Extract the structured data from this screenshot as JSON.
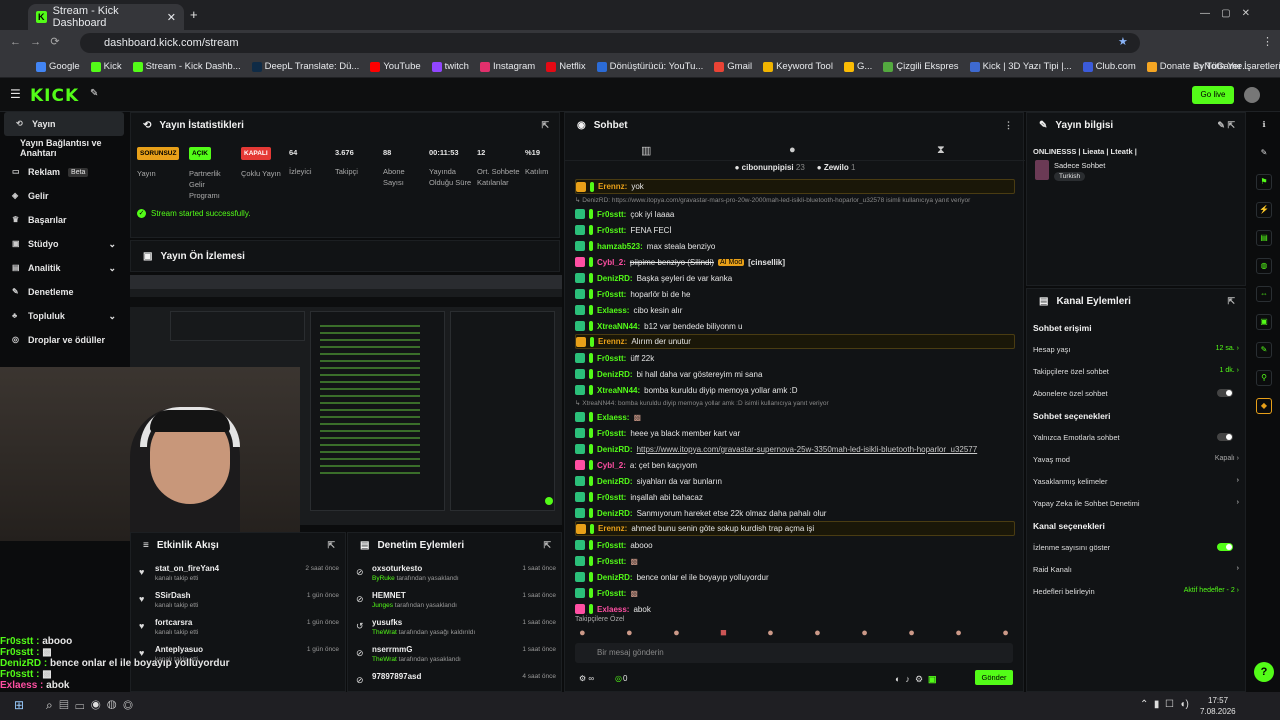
{
  "browser": {
    "tab_title": "Stream - Kick Dashboard",
    "url": "dashboard.kick.com/stream",
    "bookmarks": [
      "Google",
      "Kick",
      "Stream - Kick Dashb...",
      "DeepL Translate: Dü...",
      "YouTube",
      "twitch",
      "Instagram",
      "Netflix",
      "Dönüştürücü: YouTu...",
      "Gmail",
      "Keyword Tool",
      "G...",
      "Çizgili Ekspres",
      "Kick | 3D Yazı Tipi |...",
      "Club.com",
      "Donate ByNoGame..."
    ],
    "bookmarks_folder": "Tüm Yer İşaretleri"
  },
  "topbar": {
    "logo": "KICK",
    "go_live": "Go live"
  },
  "sidebar": {
    "items": [
      {
        "label": "Yayın"
      },
      {
        "label": "Yayın Bağlantısı ve Anahtarı"
      },
      {
        "label": "Reklam",
        "badge": "Beta"
      },
      {
        "label": "Gelir"
      },
      {
        "label": "Başarılar"
      },
      {
        "label": "Stüdyo"
      },
      {
        "label": "Analitik"
      },
      {
        "label": "Denetleme"
      },
      {
        "label": "Topluluk"
      },
      {
        "label": "Droplar ve ödüller"
      }
    ]
  },
  "stats": {
    "title": "Yayın İstatistikleri",
    "cells": [
      {
        "pill": "SORUNSUZ",
        "label": "Yayın"
      },
      {
        "pill": "AÇIK",
        "label": "Partnerlik Gelir Programı"
      },
      {
        "pill": "KAPALI",
        "label": "Çoklu Yayın"
      },
      {
        "value": "64",
        "label": "İzleyici"
      },
      {
        "value": "3.676",
        "label": "Takipçi"
      },
      {
        "value": "88",
        "label": "Abone Sayısı"
      },
      {
        "value": "00:11:53",
        "label": "Yayında Olduğu Süre"
      },
      {
        "value": "12",
        "label": "Ort. Sohbete Katılanlar"
      },
      {
        "value": "%19",
        "label": "Katılım"
      }
    ],
    "success": "Stream started successfully."
  },
  "preview": {
    "title": "Yayın Ön İzlemesi"
  },
  "events": {
    "title": "Etkinlik Akışı",
    "rows": [
      {
        "name": "stat_on_fireYan4",
        "sub": "kanalı takip etti",
        "time": "2 saat önce"
      },
      {
        "name": "SSirDash",
        "sub": "kanalı takip etti",
        "time": "1 gün önce"
      },
      {
        "name": "fortcarsra",
        "sub": "kanalı takip etti",
        "time": "1 gün önce"
      },
      {
        "name": "Anteplyasuo",
        "sub": "kanalı takip etti",
        "time": "1 gün önce"
      }
    ]
  },
  "modactions": {
    "title": "Denetim Eylemleri",
    "rows": [
      {
        "name": "oxsoturkesto",
        "by": "ByRuke",
        "sub": "tarafından yasaklandı",
        "time": "1 saat önce"
      },
      {
        "name": "HEMNET",
        "by": "Junges",
        "sub": "tarafından yasaklandı",
        "time": "1 saat önce"
      },
      {
        "name": "yusufks",
        "by": "TheWrat",
        "sub": "tarafından yasağı kaldırıldı",
        "time": "1 saat önce"
      },
      {
        "name": "nserrmmG",
        "by": "TheWrat",
        "sub": "tarafından yasaklandı",
        "time": "1 saat önce"
      },
      {
        "name": "97897897asd",
        "by": "",
        "sub": "",
        "time": "4 saat önce"
      }
    ]
  },
  "chat": {
    "title": "Sohbet",
    "pinned": [
      {
        "name": "cibonunpipisi",
        "count": "23"
      },
      {
        "name": "Zewilo",
        "count": "1"
      }
    ],
    "messages": [
      {
        "u": "Erennz",
        "c": "#e8a019",
        "t": "yok",
        "hl": true
      },
      {
        "reply": "DenizRD: https://www.itopya.com/gravastar-mars-pro-20w-2000mah-led-isikli-bluetooth-hoparlor_u32578 isimli kullanıcıya yanıt veriyor"
      },
      {
        "u": "Fr0sstt",
        "c": "#53fc18",
        "t": "çok iyi laaaa"
      },
      {
        "u": "Fr0sstt",
        "c": "#53fc18",
        "t": "FENA FECİ"
      },
      {
        "u": "hamzab523",
        "c": "#53fc18",
        "t": "max steala benziyo"
      },
      {
        "u": "Cybl_2",
        "c": "#ff4fa3",
        "t": "piipime benziyo (Silindi)",
        "ai": "AI Mod",
        "tag": "[cinsellik]"
      },
      {
        "u": "DenizRD",
        "c": "#53fc18",
        "t": "Başka şeyleri de var kanka"
      },
      {
        "u": "Fr0sstt",
        "c": "#53fc18",
        "t": "hoparlör bi de he"
      },
      {
        "u": "Exlaess",
        "c": "#53fc18",
        "t": "cibo kesin alır"
      },
      {
        "u": "XtreaNN44",
        "c": "#53fc18",
        "t": "b12 var bendede biliyonm u"
      },
      {
        "u": "Erennz",
        "c": "#e8a019",
        "t": "Alırım der unutur",
        "hl": true
      },
      {
        "u": "Fr0sstt",
        "c": "#53fc18",
        "t": "üff 22k"
      },
      {
        "u": "DenizRD",
        "c": "#53fc18",
        "t": "bi hall daha var göstereyim mi sana"
      },
      {
        "u": "XtreaNN44",
        "c": "#53fc18",
        "t": "bomba kuruldu diyip memoya yollar amk :D"
      },
      {
        "reply": "XtreaNN44: bomba kuruldu diyip memoya yollar amk :D isimli kullanıcıya yanıt veriyor"
      },
      {
        "u": "Exlaess",
        "c": "#53fc18",
        "t": ""
      },
      {
        "u": "Fr0sstt",
        "c": "#53fc18",
        "t": "heee ya black member kart var"
      },
      {
        "u": "DenizRD",
        "c": "#53fc18",
        "t": "https://www.itopya.com/gravastar-supernova-25w-3350mah-led-isikli-bluetooth-hoparlor_u32577",
        "link": true
      },
      {
        "u": "Cybl_2",
        "c": "#ff4fa3",
        "t": "a: çet ben kaçıyom"
      },
      {
        "u": "DenizRD",
        "c": "#53fc18",
        "t": "siyahları da var bunların"
      },
      {
        "u": "Fr0sstt",
        "c": "#53fc18",
        "t": "inşallah abi bahacaz"
      },
      {
        "u": "DenizRD",
        "c": "#53fc18",
        "t": "Sanmıyorum hareket etse 22k olmaz daha pahalı olur"
      },
      {
        "u": "Erennz",
        "c": "#e8a019",
        "t": "ahmed bunu senin göte sokup kurdish trap açma işi",
        "hl": true
      },
      {
        "u": "Fr0sstt",
        "c": "#53fc18",
        "t": "abooo"
      },
      {
        "u": "Fr0sstt",
        "c": "#53fc18",
        "t": ""
      },
      {
        "u": "DenizRD",
        "c": "#53fc18",
        "t": "bence onlar el ile boyayıp yolluyordur"
      },
      {
        "u": "Fr0sstt",
        "c": "#53fc18",
        "t": ""
      },
      {
        "u": "Exlaess",
        "c": "#ff4fa3",
        "t": "abok"
      }
    ],
    "followers_label": "Takipçilere Özel",
    "input_placeholder": "Bir mesaj gönderin",
    "counter": "0",
    "send": "Gönder"
  },
  "info": {
    "title": "Yayın bilgisi",
    "stream_title": "ONLINESSS | Lieata | Lteatk |",
    "category": "Sadece Sohbet",
    "tag": "Turkish"
  },
  "actions": {
    "title": "Kanal Eylemleri",
    "rows": [
      {
        "h": "Sohbet erişimi"
      },
      {
        "l": "Hesap yaşı",
        "v": "12 sa."
      },
      {
        "l": "Takipçilere özel sohbet",
        "v": "1 dk."
      },
      {
        "l": "Abonelere özel sohbet",
        "toggle": "off"
      },
      {
        "h": "Sohbet seçenekleri"
      },
      {
        "l": "Yalnızca Emotlarla sohbet",
        "toggle": "off"
      },
      {
        "l": "Yavaş mod",
        "v": "Kapalı"
      },
      {
        "l": "Yasaklanmış kelimeler"
      },
      {
        "l": "Yapay Zeka ile Sohbet Denetimi"
      },
      {
        "h": "Kanal seçenekleri"
      },
      {
        "l": "İzlenme sayısını göster",
        "toggle": "on"
      },
      {
        "l": "Raid Kanalı"
      },
      {
        "l": "Hedefleri belirleyin",
        "v": "Aktif hedefler - 2"
      }
    ]
  },
  "overlay": {
    "lines": [
      {
        "u": "Fr0sstt",
        "t": "abooo",
        "c": "#53fc18"
      },
      {
        "u": "Fr0sstt",
        "t": "",
        "c": "#53fc18"
      },
      {
        "u": "DenizRD",
        "t": "bence onlar el ile boyayıp yolluyordur",
        "c": "#53fc18"
      },
      {
        "u": "Fr0sstt",
        "t": "",
        "c": "#53fc18"
      },
      {
        "u": "Exlaess",
        "t": "abok",
        "c": "#ff4fa3"
      }
    ]
  },
  "taskbar": {
    "time": "17:57",
    "date": "7.08.2026"
  }
}
